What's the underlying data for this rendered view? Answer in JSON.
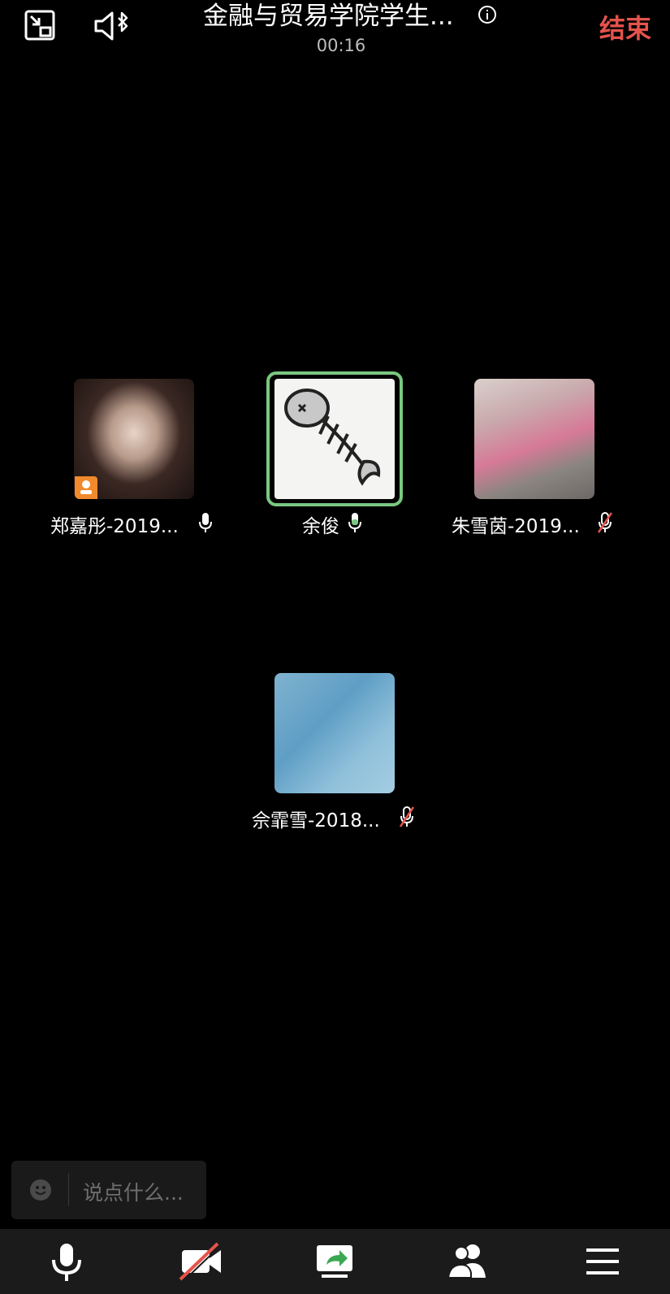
{
  "header": {
    "title": "金融与贸易学院学生...",
    "timer": "00:16",
    "end_label": "结束",
    "icons": [
      "minimize-window-icon",
      "speaker-bluetooth-icon",
      "info-icon"
    ]
  },
  "participants": [
    {
      "name": "郑嘉彤-2019...",
      "mic": "on",
      "host_badge": true
    },
    {
      "name": "余俊",
      "mic": "on",
      "speaking": true
    },
    {
      "name": "朱雪茵-2019...",
      "mic": "muted"
    },
    {
      "name": "佘霏雪-2018...",
      "mic": "muted"
    }
  ],
  "chat": {
    "placeholder": "说点什么...",
    "icon": "emoji-icon"
  },
  "toolbar": {
    "items": [
      "microphone-icon",
      "camera-off-icon",
      "share-screen-icon",
      "participants-icon",
      "menu-icon"
    ]
  },
  "colors": {
    "end_red": "#e5534b",
    "speaking_green": "#79c780",
    "host_badge_orange": "#f08a2c",
    "muted_red": "#e5534b"
  }
}
